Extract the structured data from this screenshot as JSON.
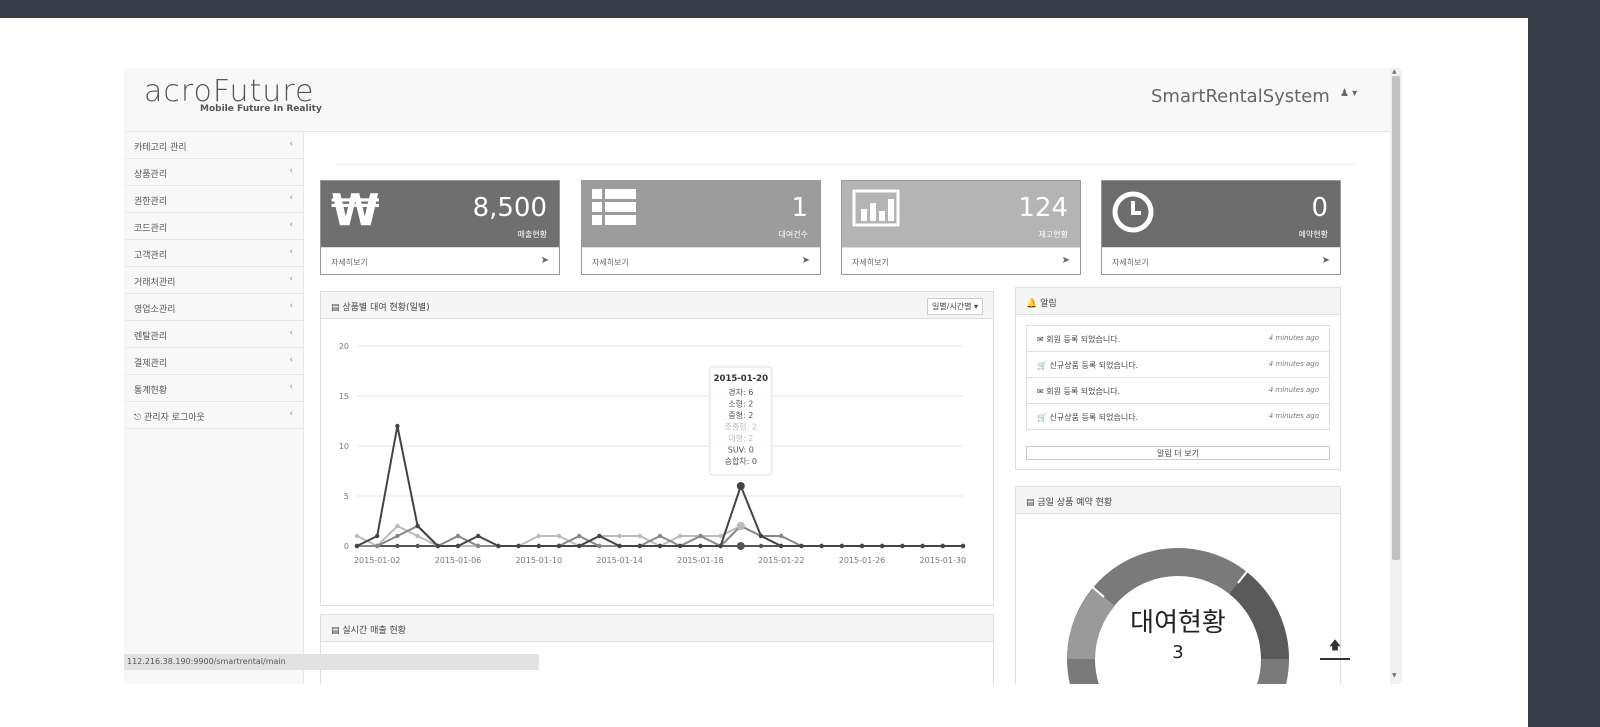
{
  "header": {
    "logo_main": "acroFuture",
    "logo_sub": "Mobile Future In Reality",
    "app_title": "SmartRentalSystem",
    "user_menu": "▾"
  },
  "sidebar": {
    "items": [
      {
        "label": "카테고리 관리"
      },
      {
        "label": "상품관리"
      },
      {
        "label": "권한관리"
      },
      {
        "label": "코드관리"
      },
      {
        "label": "고객관리"
      },
      {
        "label": "거래처관리"
      },
      {
        "label": "영업소관리"
      },
      {
        "label": "렌탈관리"
      },
      {
        "label": "결제관리"
      },
      {
        "label": "통계현황"
      },
      {
        "label": "관리자 로그아웃"
      }
    ]
  },
  "stats": [
    {
      "value": "8,500",
      "label": "매출현황",
      "link": "자세히보기",
      "icon": "won-icon",
      "color": "#6f6f6f"
    },
    {
      "value": "1",
      "label": "대여건수",
      "link": "자세히보기",
      "icon": "list-icon",
      "color": "#9c9c9c"
    },
    {
      "value": "124",
      "label": "재고현황",
      "link": "자세히보기",
      "icon": "bar-chart-icon",
      "color": "#b4b4b4"
    },
    {
      "value": "0",
      "label": "예약현황",
      "link": "자세히보기",
      "icon": "clock-icon",
      "color": "#6c6c6c"
    }
  ],
  "rental_panel": {
    "title": "상품별 대여 현황(일별)",
    "dropdown": "일별/시간별"
  },
  "chart_data": {
    "type": "line",
    "x": [
      "2015-01-01",
      "2015-01-02",
      "2015-01-03",
      "2015-01-04",
      "2015-01-05",
      "2015-01-06",
      "2015-01-07",
      "2015-01-08",
      "2015-01-09",
      "2015-01-10",
      "2015-01-11",
      "2015-01-12",
      "2015-01-13",
      "2015-01-14",
      "2015-01-15",
      "2015-01-16",
      "2015-01-17",
      "2015-01-18",
      "2015-01-19",
      "2015-01-20",
      "2015-01-21",
      "2015-01-22",
      "2015-01-23",
      "2015-01-24",
      "2015-01-25",
      "2015-01-26",
      "2015-01-27",
      "2015-01-28",
      "2015-01-29",
      "2015-01-30",
      "2015-01-31"
    ],
    "xticks": [
      "2015-01-02",
      "2015-01-06",
      "2015-01-10",
      "2015-01-14",
      "2015-01-18",
      "2015-01-22",
      "2015-01-26",
      "2015-01-30"
    ],
    "yticks": [
      0,
      5,
      10,
      15,
      20
    ],
    "ylim": [
      0,
      20
    ],
    "grid": true,
    "series": [
      {
        "name": "경차",
        "color": "#444444",
        "values": [
          0,
          1,
          12,
          2,
          0,
          0,
          1,
          0,
          0,
          0,
          0,
          0,
          1,
          0,
          0,
          0,
          0,
          0,
          0,
          6,
          1,
          0,
          0,
          0,
          0,
          0,
          0,
          0,
          0,
          0,
          0
        ]
      },
      {
        "name": "소형",
        "color": "#888888",
        "values": [
          0,
          0,
          1,
          2,
          0,
          1,
          0,
          0,
          0,
          0,
          0,
          1,
          0,
          0,
          0,
          1,
          0,
          1,
          0,
          2,
          1,
          1,
          0,
          0,
          0,
          0,
          0,
          0,
          0,
          0,
          0
        ]
      },
      {
        "name": "중형",
        "color": "#bbbbbb",
        "values": [
          1,
          0,
          2,
          1,
          0,
          0,
          0,
          0,
          0,
          1,
          1,
          0,
          1,
          1,
          1,
          0,
          1,
          1,
          1,
          2,
          1,
          0,
          0,
          0,
          0,
          0,
          0,
          0,
          0,
          0,
          0
        ]
      },
      {
        "name": "SUV",
        "color": "#555555",
        "values": [
          0,
          0,
          0,
          0,
          0,
          0,
          0,
          0,
          0,
          0,
          0,
          0,
          0,
          0,
          0,
          0,
          0,
          0,
          0,
          0,
          0,
          0,
          0,
          0,
          0,
          0,
          0,
          0,
          0,
          0,
          0
        ]
      }
    ],
    "tooltip": {
      "title": "2015-01-20",
      "lines": [
        "경차: 6",
        "소형: 2",
        "중형: 2",
        "준중형: 2",
        "대형: 2",
        "SUV: 0",
        "승합차: 0"
      ]
    }
  },
  "notifications": {
    "title": "알림",
    "items": [
      {
        "text": "회원 등록 되었습니다.",
        "time": "4 minutes ago",
        "icon": "envelope-icon"
      },
      {
        "text": "신규상품 등록 되었습니다.",
        "time": "4 minutes ago",
        "icon": "cart-icon"
      },
      {
        "text": "회원 등록 되었습니다.",
        "time": "4 minutes ago",
        "icon": "envelope-icon"
      },
      {
        "text": "신규상품 등록 되었습니다.",
        "time": "4 minutes ago",
        "icon": "cart-icon"
      }
    ],
    "more": "알림 더 보기"
  },
  "reservation_panel": {
    "title": "금일 상품 예약 현황",
    "donut_label": "대여현황",
    "donut_value": "3"
  },
  "sales_panel": {
    "title": "실시간 매출 현황"
  },
  "statusbar": {
    "url": "112.216.38.190:9900/smartrental/main"
  }
}
